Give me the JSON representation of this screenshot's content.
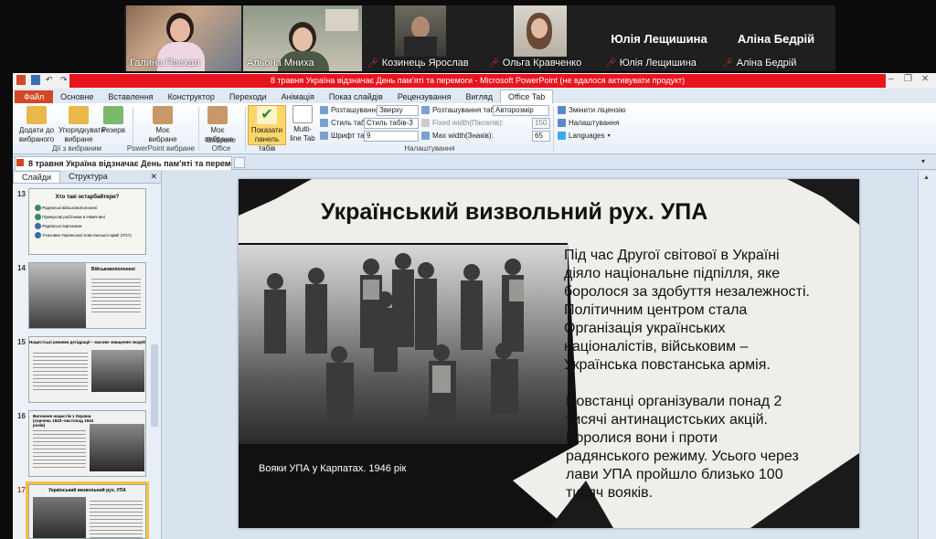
{
  "participants": [
    {
      "name": "Галина Пасхал",
      "muted": false
    },
    {
      "name": "Альона Мниха",
      "muted": false
    },
    {
      "name": "Козинець Ярослав",
      "muted": true
    },
    {
      "name": "Ольга Кравченко",
      "muted": true
    },
    {
      "name": "Юлія Лещишина",
      "muted": true
    },
    {
      "name": "Аліна Бедрій",
      "muted": true
    }
  ],
  "name_tiles": [
    "Юлія Лещишина",
    "Аліна Бедрій"
  ],
  "window": {
    "title": "8 травня Україна відзначає День пам'яті та перемоги  -  Microsoft PowerPoint (не вдалося активувати продукт)"
  },
  "ribbon_tabs": [
    "Файл",
    "Основне",
    "Вставлення",
    "Конструктор",
    "Переходи",
    "Анімація",
    "Показ слайдів",
    "Рецензування",
    "Вигляд",
    "Office Tab"
  ],
  "ribbon": {
    "add_fav": "Додати до вибраного",
    "organize": "Упорядкувати вибране",
    "reserve": "Резерв",
    "g1": "Дії з вибраним",
    "my_fav1": "Моє вибране",
    "g2": "PowerPoint вибране",
    "my_fav2": "Моє вибране",
    "g3": "Вибране Office",
    "show_panel": "Показати панель табів",
    "multiline": "Multi-line Tab",
    "placement_label": "Розташування:",
    "placement_val": "Зверху",
    "style_label": "Стиль табів:",
    "style_val": "Стиль табів-3",
    "font_label": "Шрифт табу:",
    "font_val": "9",
    "tabpos_label": "Розташування табів:",
    "tabpos_val": "Авторозмір",
    "fixed_label": "Fixed width(Пікселів):",
    "fixed_val": "150",
    "max_label": "Max width(Знаків):",
    "max_val": "65",
    "g4": "Налаштування",
    "change_license": "Змінити ліцензію",
    "settings": "Налаштування",
    "languages": "Languages"
  },
  "doc_tab": "8 травня Україна відзначає День пам'яті та перемоги",
  "panel_tabs": [
    "Слайди",
    "Структура"
  ],
  "thumbs": [
    {
      "num": "13",
      "title": "Хто такі остарбайтери?",
      "items": [
        "Радянські військовополонені",
        "Примусові робітники в Німеччині",
        "Радянські партизани",
        "Учасники Української повстанської армії (УПА)"
      ]
    },
    {
      "num": "14",
      "title": "Військовополонені"
    },
    {
      "num": "15",
      "title": "Нацистські режими дегідрації – масове знищення людей"
    },
    {
      "num": "16",
      "title": "Вигнання нацистів з України (серпень 1943–листопад 1944 років)"
    },
    {
      "num": "17",
      "title": "Український визвольний рух. УПА"
    }
  ],
  "slide": {
    "title": "Український визвольний рух. УПА",
    "p1_lines": [
      "Під час Другої світової в Україні",
      "діяло національне підпілля, яке",
      "боролося за здобуття незалежності.",
      "Політичним центром стала",
      "Організація українських",
      "націоналістів, військовим –",
      "Українська повстанська армія."
    ],
    "p2_lines": [
      "Повстанці організували понад 2",
      "тисячі антинацистських акцій.",
      "Боролися вони і проти",
      "радянського режиму. Усього через",
      "лави УПА пройшло близько 100",
      "тисяч вояків."
    ],
    "caption": "Вояки УПА у Карпатах. 1946 рік"
  },
  "colors": {
    "accent_red": "#e8141e",
    "file_tab": "#d24726",
    "active_speaker": "#3fbf4c"
  }
}
